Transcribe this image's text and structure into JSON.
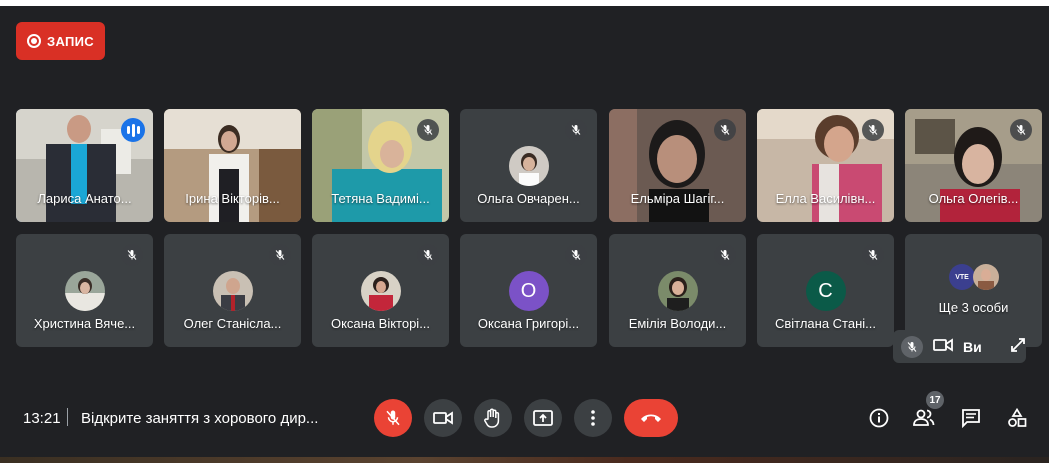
{
  "recording": {
    "label": "ЗАПИС"
  },
  "participants_row1": [
    {
      "name": "Лариса Анато..."
    },
    {
      "name": "Ірина Вікторів..."
    },
    {
      "name": "Тетяна Вадимі..."
    },
    {
      "name": "Ольга Овчарен..."
    },
    {
      "name": "Ельміра Шагіг..."
    },
    {
      "name": "Елла Василівн..."
    },
    {
      "name": "Ольга Олегів..."
    }
  ],
  "participants_row2": [
    {
      "name": "Христина Вяче..."
    },
    {
      "name": "Олег Станісла..."
    },
    {
      "name": "Оксана Вікторі..."
    },
    {
      "name": "Оксана Григорі...",
      "initial": "О"
    },
    {
      "name": "Емілія Володи..."
    },
    {
      "name": "Світлана Стані...",
      "initial": "С"
    }
  ],
  "more": {
    "label": "Ще 3 особи",
    "avatar_text": "VTE"
  },
  "self_view": {
    "label": "Ви"
  },
  "meeting": {
    "time": "13:21",
    "title": "Відкрите заняття з хорового дир..."
  },
  "participants_count": "17",
  "colors": {
    "bg": "#202124",
    "tile": "#3c4043",
    "red": "#ea4335",
    "active": "#8ab4f8",
    "purple": "#7b52c7",
    "teal": "#0b5a48"
  }
}
